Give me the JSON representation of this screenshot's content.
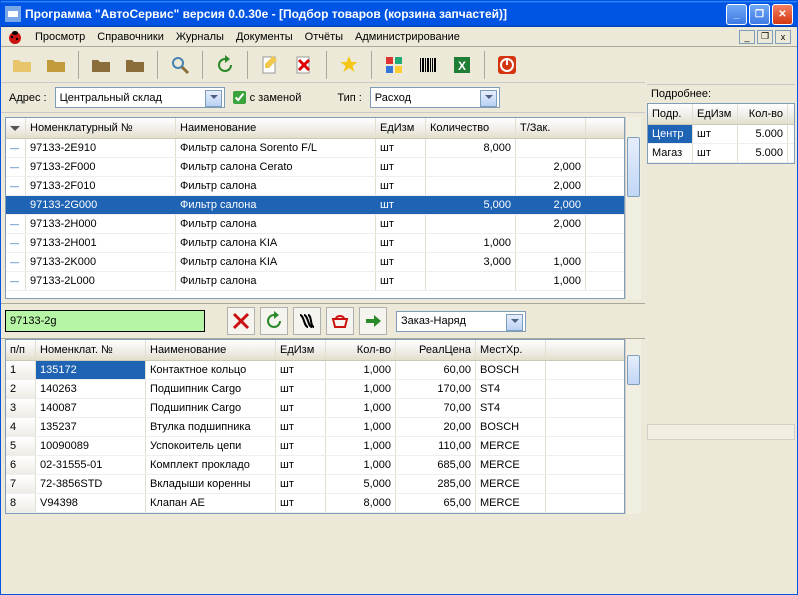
{
  "title": "Программа \"АвтоСервис\" версия 0.0.30e - [Подбор товаров (корзина запчастей)]",
  "menu": [
    "Просмотр",
    "Справочники",
    "Журналы",
    "Документы",
    "Отчёты",
    "Администрирование"
  ],
  "addr_label": "Адрес :",
  "addr_value": "Центральный склад",
  "replace_label": "с заменой",
  "type_label": "Тип :",
  "type_value": "Расход",
  "upper": {
    "headers": [
      "",
      "Номенклатурный №",
      "Наименование",
      "ЕдИзм",
      "Количество",
      "Т/Зак."
    ],
    "rows": [
      {
        "n": "97133-2E910",
        "name": "Фильтр салона Sorento F/L",
        "u": "шт",
        "q": "8,000",
        "t": ""
      },
      {
        "n": "97133-2F000",
        "name": "Фильтр салона Cerato",
        "u": "шт",
        "q": "",
        "t": "2,000"
      },
      {
        "n": "97133-2F010",
        "name": "Фильтр салона",
        "u": "шт",
        "q": "",
        "t": "2,000"
      },
      {
        "n": "97133-2G000",
        "name": "Фильтр салона",
        "u": "шт",
        "q": "5,000",
        "t": "2,000"
      },
      {
        "n": "97133-2H000",
        "name": "Фильтр салона",
        "u": "шт",
        "q": "",
        "t": "2,000"
      },
      {
        "n": "97133-2H001",
        "name": "Фильтр салона KIA",
        "u": "шт",
        "q": "1,000",
        "t": ""
      },
      {
        "n": "97133-2K000",
        "name": "Фильтр салона KIA",
        "u": "шт",
        "q": "3,000",
        "t": "1,000"
      },
      {
        "n": "97133-2L000",
        "name": "Фильтр салона",
        "u": "шт",
        "q": "",
        "t": "1,000"
      }
    ],
    "selected": 3
  },
  "search_value": "97133-2g",
  "order_label": "Заказ-Наряд",
  "lower": {
    "headers": [
      "п/п",
      "Номенклат. №",
      "Наименование",
      "ЕдИзм",
      "Кол-во",
      "РеалЦена",
      "МестХр."
    ],
    "rows": [
      {
        "i": "1",
        "n": "135172",
        "name": "Контактное кольцо",
        "u": "шт",
        "q": "1,000",
        "p": "60,00",
        "m": "BOSCH"
      },
      {
        "i": "2",
        "n": "140263",
        "name": "Подшипник Cargo",
        "u": "шт",
        "q": "1,000",
        "p": "170,00",
        "m": "ST4"
      },
      {
        "i": "3",
        "n": "140087",
        "name": "Подшипник Cargo",
        "u": "шт",
        "q": "1,000",
        "p": "70,00",
        "m": "ST4"
      },
      {
        "i": "4",
        "n": "135237",
        "name": "Втулка подшипника",
        "u": "шт",
        "q": "1,000",
        "p": "20,00",
        "m": "BOSCH"
      },
      {
        "i": "5",
        "n": "10090089",
        "name": "Успокоитель цепи",
        "u": "шт",
        "q": "1,000",
        "p": "110,00",
        "m": "MERCE"
      },
      {
        "i": "6",
        "n": "02-31555-01",
        "name": "Комплект прокладо",
        "u": "шт",
        "q": "1,000",
        "p": "685,00",
        "m": "MERCE"
      },
      {
        "i": "7",
        "n": "72-3856STD",
        "name": "Вкладыши коренны",
        "u": "шт",
        "q": "5,000",
        "p": "285,00",
        "m": "MERCE"
      },
      {
        "i": "8",
        "n": "V94398",
        "name": "Клапан AE",
        "u": "шт",
        "q": "8,000",
        "p": "65,00",
        "m": "MERCE"
      }
    ],
    "selected": 0
  },
  "right": {
    "title": "Подробнее:",
    "headers": [
      "Подр.",
      "ЕдИзм",
      "Кол-во"
    ],
    "rows": [
      {
        "p": "Центр",
        "u": "шт",
        "q": "5.000"
      },
      {
        "p": "Магаз",
        "u": "шт",
        "q": "5.000"
      }
    ],
    "selected": 0
  }
}
